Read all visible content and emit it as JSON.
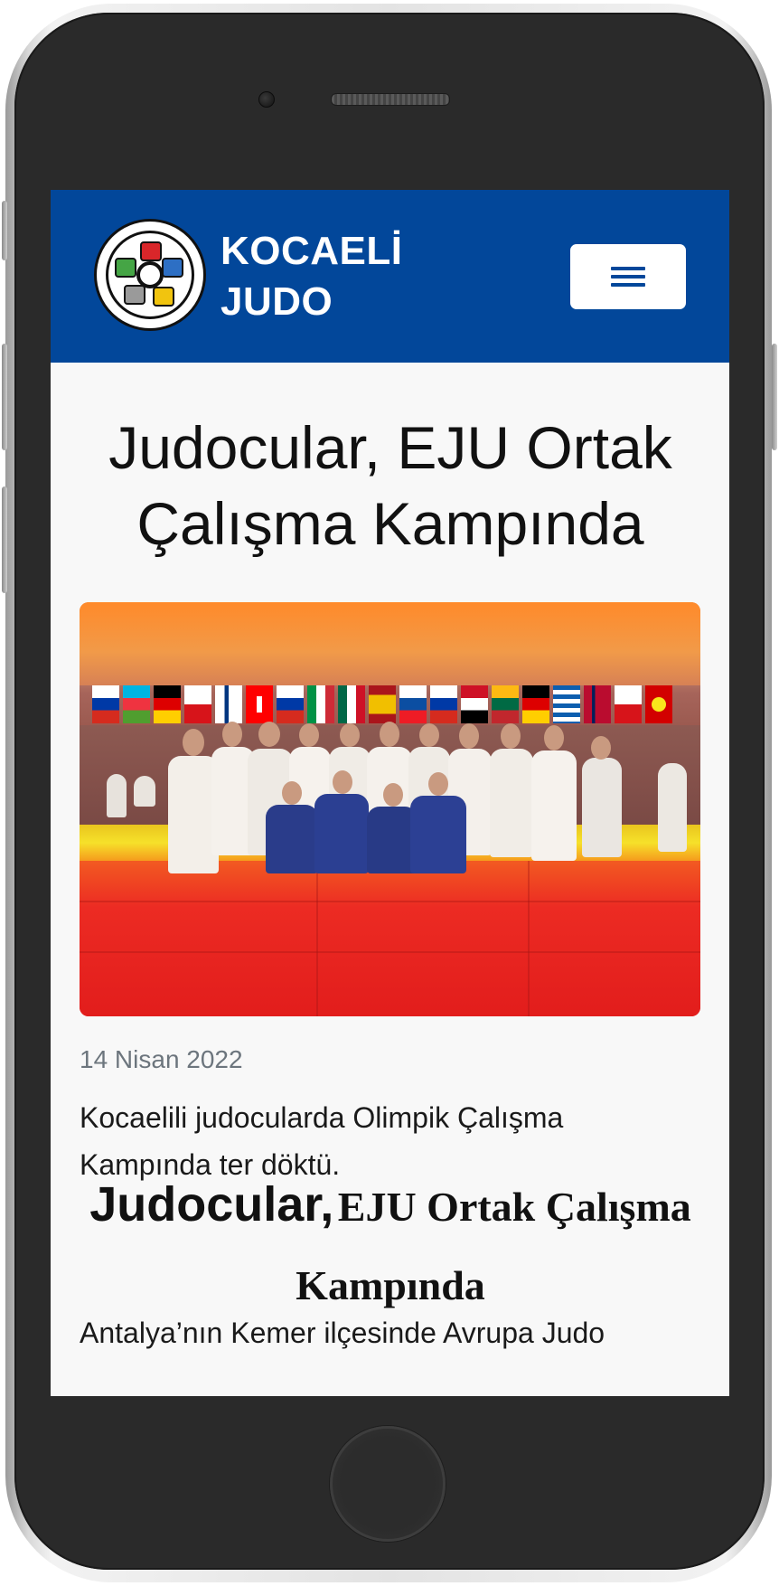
{
  "navbar": {
    "brand_line1": "KOCAELİ",
    "brand_line2": "JUDO",
    "logo_icon": "international-judo-federation-logo",
    "menu_icon": "hamburger-menu-icon",
    "background_color": "#02479a"
  },
  "article": {
    "title": "Judocular, EJU Ortak Çalışma Kampında",
    "image_icon": "team-photo-judo-camp",
    "date": "14 Nisan 2022",
    "lead": "Kocaelili judocularda Olimpik Çalışma Kampında ter döktü.",
    "subheading_part1": "Judocular,",
    "subheading_part2": "EJU Ortak Çalışma Kampında",
    "body_start": "Antalya’nın Kemer ilçesinde Avrupa Judo"
  }
}
